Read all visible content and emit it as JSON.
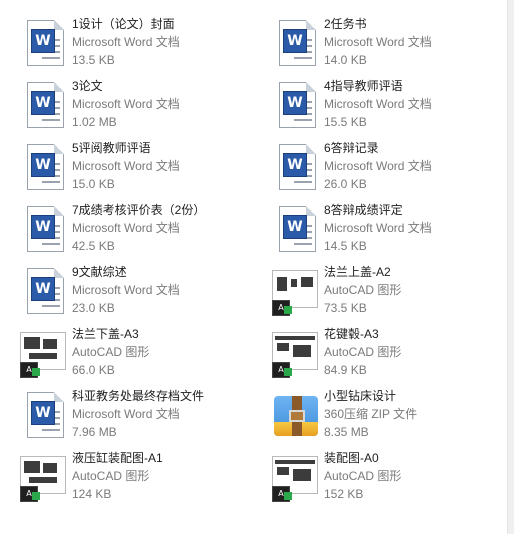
{
  "items": [
    {
      "name": "1设计（论文）封面",
      "type": "Microsoft Word 文档",
      "size": "13.5 KB",
      "icon": "word-doc-icon",
      "kind": "word"
    },
    {
      "name": "2任务书",
      "type": "Microsoft Word 文档",
      "size": "14.0 KB",
      "icon": "word-doc-icon",
      "kind": "word"
    },
    {
      "name": "3论文",
      "type": "Microsoft Word 文档",
      "size": "1.02 MB",
      "icon": "word-doc-icon",
      "kind": "word"
    },
    {
      "name": "4指导教师评语",
      "type": "Microsoft Word 文档",
      "size": "15.5 KB",
      "icon": "word-doc-icon",
      "kind": "word"
    },
    {
      "name": "5评阅教师评语",
      "type": "Microsoft Word 文档",
      "size": "15.0 KB",
      "icon": "word-doc-icon",
      "kind": "word"
    },
    {
      "name": "6答辩记录",
      "type": "Microsoft Word 文档",
      "size": "26.0 KB",
      "icon": "word-doc-icon",
      "kind": "word"
    },
    {
      "name": "7成绩考核评价表（2份）",
      "type": "Microsoft Word 文档",
      "size": "42.5 KB",
      "icon": "word-doc-icon",
      "kind": "word"
    },
    {
      "name": "8答辩成绩评定",
      "type": "Microsoft Word 文档",
      "size": "14.5 KB",
      "icon": "word-doc-icon",
      "kind": "word"
    },
    {
      "name": "9文献综述",
      "type": "Microsoft Word 文档",
      "size": "23.0 KB",
      "icon": "word-doc-icon",
      "kind": "word"
    },
    {
      "name": "法兰上盖-A2",
      "type": "AutoCAD 图形",
      "size": "73.5 KB",
      "icon": "autocad-drawing-icon",
      "kind": "cad"
    },
    {
      "name": "法兰下盖-A3",
      "type": "AutoCAD 图形",
      "size": "66.0 KB",
      "icon": "autocad-drawing-icon",
      "kind": "cad"
    },
    {
      "name": "花键毂-A3",
      "type": "AutoCAD 图形",
      "size": "84.9 KB",
      "icon": "autocad-drawing-icon",
      "kind": "cad"
    },
    {
      "name": "科亚教务处最终存档文件",
      "type": "Microsoft Word 文档",
      "size": "7.96 MB",
      "icon": "word-doc-icon",
      "kind": "word"
    },
    {
      "name": "小型钻床设计",
      "type": "360压缩 ZIP 文件",
      "size": "8.35 MB",
      "icon": "zip-archive-icon",
      "kind": "zip"
    },
    {
      "name": "液压缸装配图-A1",
      "type": "AutoCAD 图形",
      "size": "124 KB",
      "icon": "autocad-drawing-icon",
      "kind": "cad"
    },
    {
      "name": "装配图-A0",
      "type": "AutoCAD 图形",
      "size": "152 KB",
      "icon": "autocad-drawing-icon",
      "kind": "cad"
    }
  ],
  "glyphs": {
    "word_badge": "W",
    "cad_badge": "A"
  }
}
